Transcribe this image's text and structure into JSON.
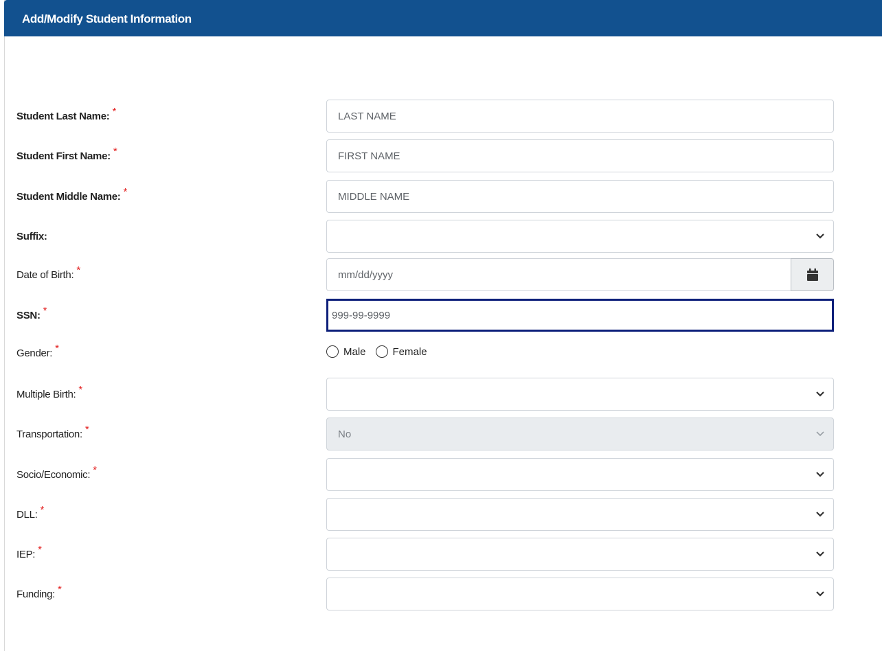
{
  "header": {
    "title": "Add/Modify Student Information"
  },
  "form": {
    "last_name": {
      "label": "Student Last Name:",
      "placeholder": "LAST NAME"
    },
    "first_name": {
      "label": "Student First Name:",
      "placeholder": "FIRST NAME"
    },
    "middle_name": {
      "label": "Student Middle Name:",
      "placeholder": "MIDDLE NAME"
    },
    "suffix": {
      "label": "Suffix:",
      "value": ""
    },
    "dob": {
      "label": "Date of Birth:",
      "placeholder": "mm/dd/yyyy",
      "button_icon": "calendar-icon"
    },
    "ssn": {
      "label": "SSN:",
      "placeholder": "999-99-9999"
    },
    "gender": {
      "label": "Gender:",
      "options": [
        "Male",
        "Female"
      ]
    },
    "multiple_birth": {
      "label": "Multiple Birth:",
      "value": ""
    },
    "transportation": {
      "label": "Transportation:",
      "value": "No"
    },
    "socio_economic": {
      "label": "Socio/Economic:",
      "value": ""
    },
    "dll": {
      "label": "DLL:",
      "value": ""
    },
    "iep": {
      "label": "IEP:",
      "value": ""
    },
    "funding": {
      "label": "Funding:",
      "value": ""
    }
  },
  "required_marker": "*",
  "colors": {
    "header_bg": "#12518f",
    "required": "#e32020",
    "focus_border": "#0d1f7a"
  }
}
